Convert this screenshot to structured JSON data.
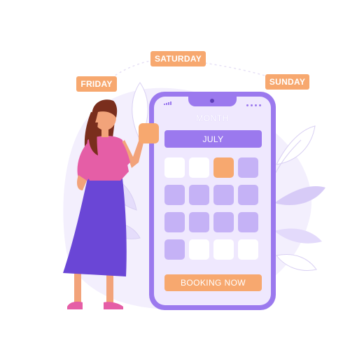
{
  "tags": {
    "friday": "FRIDAY",
    "saturday": "SATURDAY",
    "sunday": "SUNDAY"
  },
  "phone": {
    "month_label": "MONTH",
    "month_value": "JULY",
    "calendar_cells": [
      "white",
      "white",
      "orange",
      "purple",
      "purple",
      "purple",
      "purple",
      "purple",
      "purple",
      "purple",
      "purple",
      "purple",
      "purple",
      "white",
      "white",
      "white"
    ],
    "booking_label": "BOOKING NOW"
  },
  "colors": {
    "accent_orange": "#f7a86f",
    "phone_purple": "#9b79ee",
    "cell_purple": "#c5b2f6",
    "screen_bg": "#efe8fe",
    "skirt": "#6a46d6",
    "shirt": "#e55ea6"
  }
}
